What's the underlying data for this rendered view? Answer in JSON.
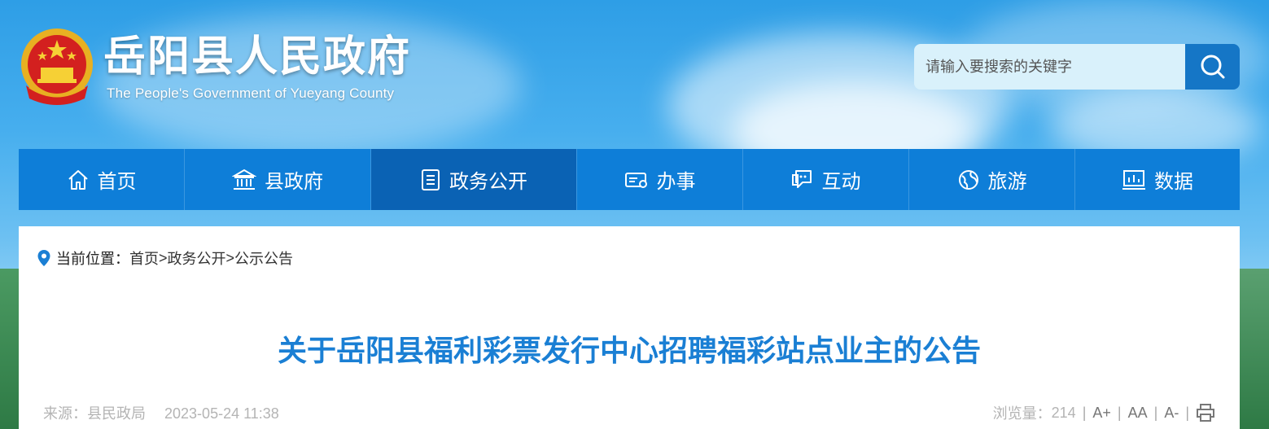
{
  "header": {
    "title": "岳阳县人民政府",
    "subtitle": "The People's Government of Yueyang County",
    "emblem_icon": "national-emblem-icon"
  },
  "search": {
    "placeholder": "请输入要搜索的关键字",
    "button_icon": "search-icon"
  },
  "nav": {
    "items": [
      {
        "label": "首页",
        "icon": "home-icon"
      },
      {
        "label": "县政府",
        "icon": "government-building-icon"
      },
      {
        "label": "政务公开",
        "icon": "document-list-icon"
      },
      {
        "label": "办事",
        "icon": "id-card-icon"
      },
      {
        "label": "互动",
        "icon": "chat-icon"
      },
      {
        "label": "旅游",
        "icon": "globe-icon"
      },
      {
        "label": "数据",
        "icon": "chart-icon"
      }
    ],
    "active_index": 2
  },
  "breadcrumb": {
    "label": "当前位置：",
    "items": [
      "首页",
      "政务公开",
      "公示公告"
    ],
    "separator": ">"
  },
  "article": {
    "title": "关于岳阳县福利彩票发行中心招聘福彩站点业主的公告",
    "source": "来源：县民政局",
    "date": "2023-05-24 11:38",
    "views_label": "浏览量：",
    "views": "214",
    "font_buttons": [
      "A+",
      "AA",
      "A-"
    ],
    "print_icon": "print-icon"
  },
  "colors": {
    "nav_bg": "#0e7ed8",
    "nav_active": "#0a62b4",
    "title_blue": "#1a7fd4",
    "search_btn": "#1576c6"
  }
}
